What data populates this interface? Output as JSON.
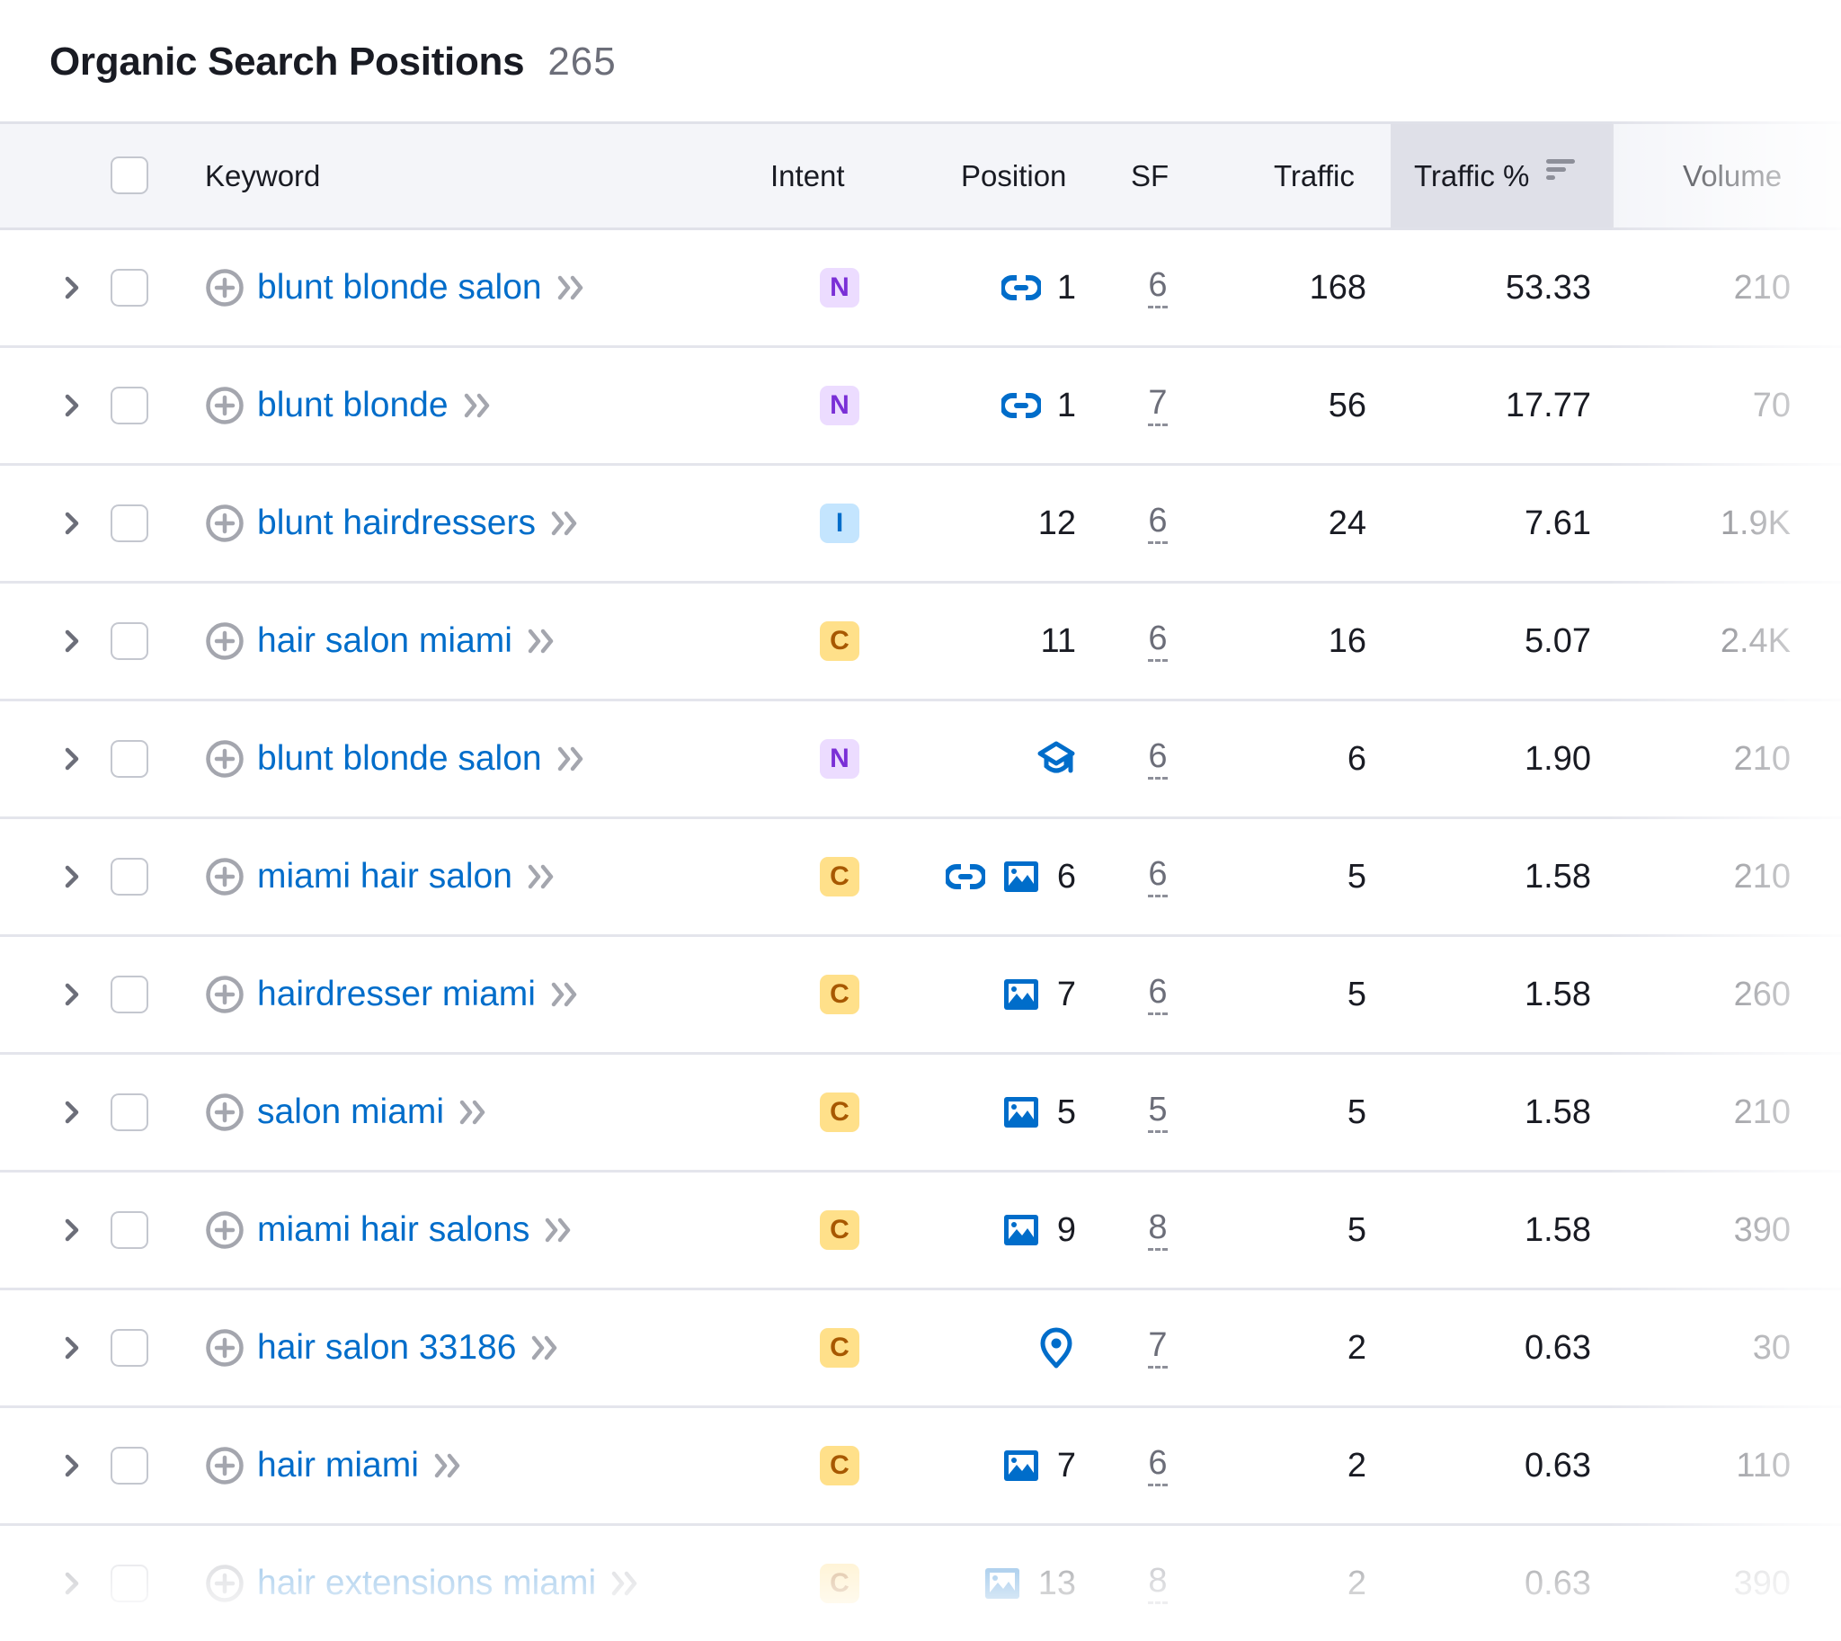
{
  "header": {
    "title": "Organic Search Positions",
    "count": "265"
  },
  "columns": {
    "keyword": "Keyword",
    "intent": "Intent",
    "position": "Position",
    "sf": "SF",
    "traffic": "Traffic",
    "traffic_pct": "Traffic %",
    "volume": "Volume"
  },
  "sorted_column": "traffic_pct",
  "intent_styles": {
    "N": {
      "bg": "#ecdcff",
      "fg": "#7a2fd6"
    },
    "I": {
      "bg": "#c4e5fe",
      "fg": "#006dca"
    },
    "C": {
      "bg": "#ffe08a",
      "fg": "#a75800"
    }
  },
  "colors": {
    "link": "#006dca",
    "icon_blue": "#006dca",
    "muted": "#a0a2aa"
  },
  "rows": [
    {
      "keyword": "blunt blonde salon",
      "intent": "N",
      "serp_icons": [
        "link-icon"
      ],
      "position": "1",
      "sf": "6",
      "traffic": "168",
      "traffic_pct": "53.33",
      "volume": "210"
    },
    {
      "keyword": "blunt blonde",
      "intent": "N",
      "serp_icons": [
        "link-icon"
      ],
      "position": "1",
      "sf": "7",
      "traffic": "56",
      "traffic_pct": "17.77",
      "volume": "70"
    },
    {
      "keyword": "blunt hairdressers",
      "intent": "I",
      "serp_icons": [],
      "position": "12",
      "sf": "6",
      "traffic": "24",
      "traffic_pct": "7.61",
      "volume": "1.9K"
    },
    {
      "keyword": "hair salon miami",
      "intent": "C",
      "serp_icons": [],
      "position": "11",
      "sf": "6",
      "traffic": "16",
      "traffic_pct": "5.07",
      "volume": "2.4K"
    },
    {
      "keyword": "blunt blonde salon",
      "intent": "N",
      "serp_icons": [
        "graduation-cap-icon"
      ],
      "position": "",
      "sf": "6",
      "traffic": "6",
      "traffic_pct": "1.90",
      "volume": "210"
    },
    {
      "keyword": "miami hair salon",
      "intent": "C",
      "serp_icons": [
        "link-icon",
        "image-icon"
      ],
      "position": "6",
      "sf": "6",
      "traffic": "5",
      "traffic_pct": "1.58",
      "volume": "210"
    },
    {
      "keyword": "hairdresser miami",
      "intent": "C",
      "serp_icons": [
        "image-icon"
      ],
      "position": "7",
      "sf": "6",
      "traffic": "5",
      "traffic_pct": "1.58",
      "volume": "260"
    },
    {
      "keyword": "salon miami",
      "intent": "C",
      "serp_icons": [
        "image-icon"
      ],
      "position": "5",
      "sf": "5",
      "traffic": "5",
      "traffic_pct": "1.58",
      "volume": "210"
    },
    {
      "keyword": "miami hair salons",
      "intent": "C",
      "serp_icons": [
        "image-icon"
      ],
      "position": "9",
      "sf": "8",
      "traffic": "5",
      "traffic_pct": "1.58",
      "volume": "390"
    },
    {
      "keyword": "hair salon 33186",
      "intent": "C",
      "serp_icons": [
        "location-pin-icon"
      ],
      "position": "",
      "sf": "7",
      "traffic": "2",
      "traffic_pct": "0.63",
      "volume": "30"
    },
    {
      "keyword": "hair miami",
      "intent": "C",
      "serp_icons": [
        "image-icon"
      ],
      "position": "7",
      "sf": "6",
      "traffic": "2",
      "traffic_pct": "0.63",
      "volume": "110"
    },
    {
      "keyword": "hair extensions miami",
      "intent": "C",
      "serp_icons": [
        "image-icon"
      ],
      "position": "13",
      "sf": "8",
      "traffic": "2",
      "traffic_pct": "0.63",
      "volume": "390"
    }
  ]
}
